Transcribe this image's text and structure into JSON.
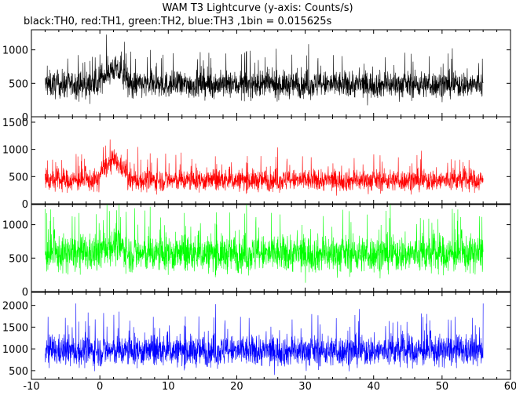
{
  "chart_data": {
    "type": "line",
    "title": "WAM T3 Lightcurve (y-axis: Counts/s)",
    "subtitle": "black:TH0, red:TH1, green:TH2, blue:TH3 ,1bin = 0.015625s",
    "xlim": [
      -10,
      60
    ],
    "x_ticks": [
      -10,
      0,
      10,
      20,
      30,
      40,
      50,
      60
    ],
    "data_x_range": [
      -8,
      56
    ],
    "bin_width_s": 0.015625,
    "grid": false,
    "panels": [
      {
        "name": "TH0",
        "color": "#000000",
        "ylim": [
          0,
          1300
        ],
        "y_ticks": [
          0,
          500,
          1000
        ],
        "baseline_mean": 480,
        "baseline_spread": 180,
        "burst": {
          "x_start": 0,
          "x_end": 4,
          "peak_mean": 720
        },
        "y_min_seen": 130,
        "y_max_seen": 1290
      },
      {
        "name": "TH1",
        "color": "#ff0000",
        "ylim": [
          0,
          1600
        ],
        "y_ticks": [
          0,
          500,
          1000,
          1500
        ],
        "baseline_mean": 430,
        "baseline_spread": 180,
        "burst": {
          "x_start": 0,
          "x_end": 4,
          "peak_mean": 800
        },
        "y_min_seen": 150,
        "y_max_seen": 1600
      },
      {
        "name": "TH2",
        "color": "#00ff00",
        "ylim": [
          0,
          1300
        ],
        "y_ticks": [
          0,
          500,
          1000
        ],
        "baseline_mean": 560,
        "baseline_spread": 250,
        "burst": {
          "x_start": 0,
          "x_end": 4,
          "peak_mean": 700
        },
        "y_min_seen": 30,
        "y_max_seen": 1300
      },
      {
        "name": "TH3",
        "color": "#0000ff",
        "ylim": [
          300,
          2300
        ],
        "y_ticks": [
          500,
          1000,
          1500,
          2000
        ],
        "baseline_mean": 950,
        "baseline_spread": 320,
        "burst": null,
        "y_min_seen": 300,
        "y_max_seen": 2300
      }
    ]
  }
}
